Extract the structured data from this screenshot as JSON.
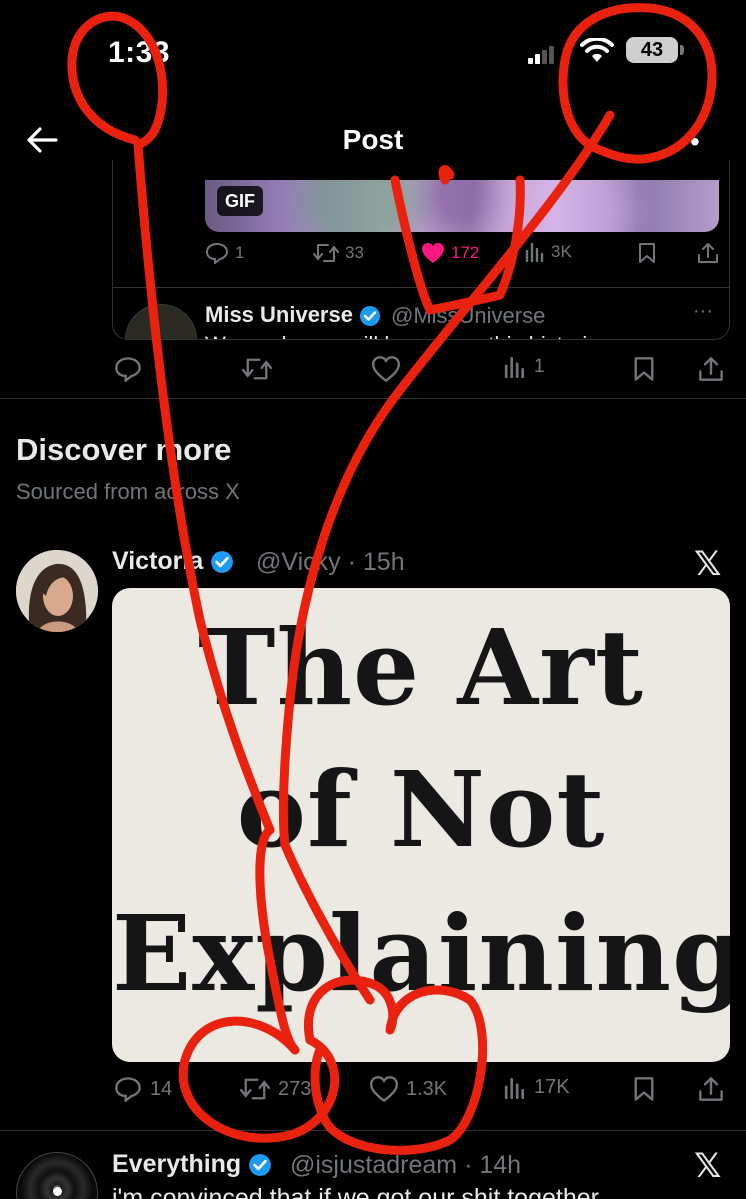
{
  "status_bar": {
    "time": "1:33",
    "battery": "43"
  },
  "nav": {
    "title": "Post"
  },
  "quoted_tweet": {
    "gif_badge": "GIF",
    "replies": "1",
    "reposts": "33",
    "likes": "172",
    "views": "3K",
    "nested": {
      "name": "Miss Universe",
      "handle": "@MissUniverse",
      "text": "We are happy will be ... to ... this histori"
    }
  },
  "post_actions": {
    "views": "1"
  },
  "discover": {
    "title": "Discover more",
    "subtitle": "Sourced from across X"
  },
  "tweet1": {
    "name": "Victoria",
    "handle": "@Vicky",
    "time": "· 15h",
    "image_text": [
      "The Art",
      "of Not",
      "Explaining"
    ],
    "replies": "14",
    "reposts": "273",
    "likes": "1.3K",
    "views": "17K"
  },
  "tweet2": {
    "name": "Everything",
    "handle": "@isjustadream",
    "time": "· 14h",
    "text": "i'm convinced that if we got our shit together"
  },
  "colors": {
    "accent_blue": "#1d9bf0",
    "like_pink": "#f91880",
    "annotation_red": "#e8220f",
    "muted": "#71767b"
  }
}
